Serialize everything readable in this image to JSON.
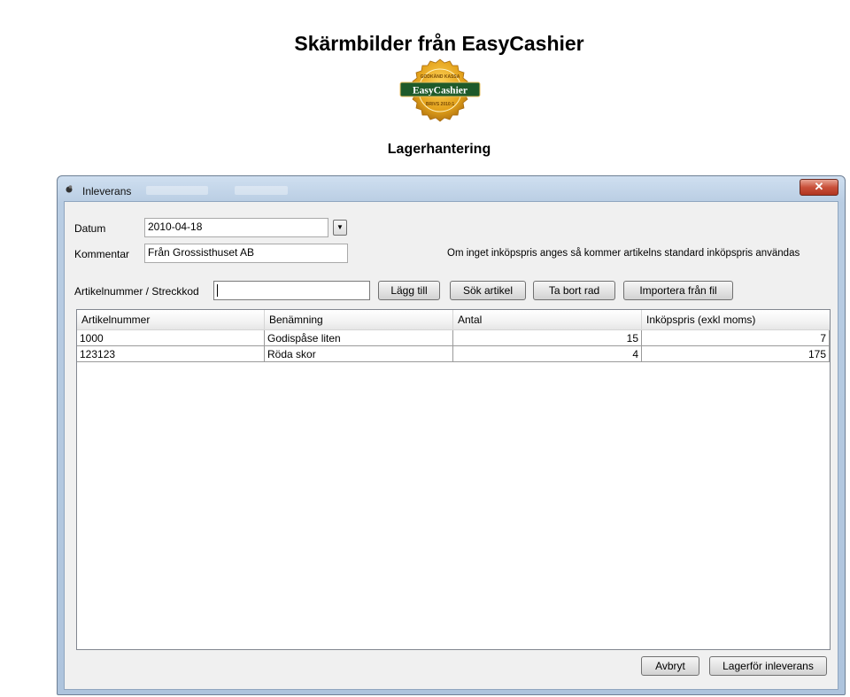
{
  "page": {
    "title": "Skärmbilder från EasyCashier",
    "section": "Lagerhantering",
    "logo": {
      "text": "EasyCashier",
      "arc_top": "GODKÄND KASSA",
      "arc_bottom": "BRIVS 2010:1",
      "colors": {
        "seal": "#e3a21b",
        "band": "#1e5a2a"
      }
    }
  },
  "window": {
    "title": "Inleverans",
    "close_glyph": "✕"
  },
  "form": {
    "datum_label": "Datum",
    "datum_value": "2010-04-18",
    "kommentar_label": "Kommentar",
    "kommentar_value": "Från Grossisthuset AB",
    "note": "Om inget inköpspris anges så kommer artikelns standard inköpspris användas",
    "artikel_label": "Artikelnummer / Streckkod",
    "artikel_value": ""
  },
  "toolbar": {
    "add": "Lägg till",
    "search": "Sök artikel",
    "remove": "Ta bort rad",
    "import": "Importera från fil"
  },
  "table": {
    "columns": [
      "Artikelnummer",
      "Benämning",
      "Antal",
      "Inköpspris (exkl moms)"
    ],
    "rows": [
      [
        "1000",
        "Godispåse liten",
        "15",
        "7"
      ],
      [
        "123123",
        "Röda skor",
        "4",
        "175"
      ]
    ]
  },
  "footer": {
    "cancel": "Avbryt",
    "submit": "Lagerför inleverans"
  },
  "colors": {
    "window_frame": "#b9cde3",
    "client_bg": "#f0f0f0",
    "close_red": "#c9503a"
  }
}
